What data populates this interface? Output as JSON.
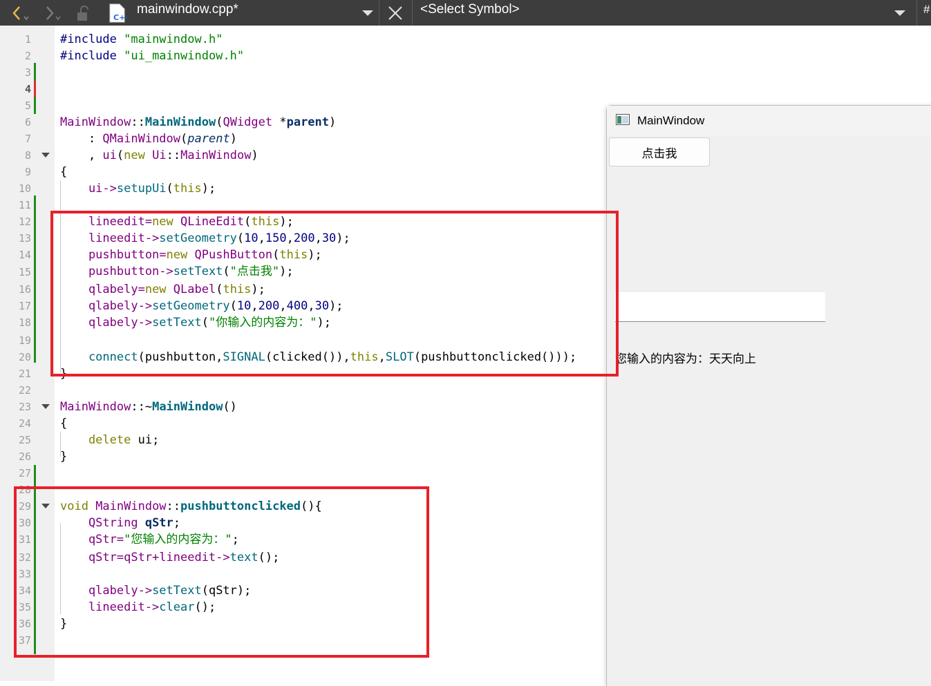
{
  "toolbar": {
    "file_name": "mainwindow.cpp*",
    "symbol_select": "<Select Symbol>",
    "hash_label": "#"
  },
  "gutter": {
    "line_numbers": [
      "1",
      "2",
      "3",
      "4",
      "5",
      "6",
      "7",
      "8",
      "9",
      "10",
      "11",
      "12",
      "13",
      "14",
      "15",
      "16",
      "17",
      "18",
      "19",
      "20",
      "21",
      "22",
      "23",
      "24",
      "25",
      "26",
      "27",
      "28",
      "29",
      "30",
      "31",
      "32",
      "33",
      "34",
      "35",
      "36",
      "37"
    ],
    "current_line": "4"
  },
  "code": {
    "line1_directive": "#include ",
    "line1_header": "\"mainwindow.h\"",
    "line2_directive": "#include ",
    "line2_header": "\"ui_mainwindow.h\"",
    "line6_class": "MainWindow",
    "line6_sep": "::",
    "line6_ctor": "MainWindow",
    "line6_open": "(",
    "line6_type": "QWidget",
    "line6_star": " *",
    "line6_param": "parent",
    "line6_close": ")",
    "line7_colon": "    : ",
    "line7_base": "QMainWindow",
    "line7_open": "(",
    "line7_arg": "parent",
    "line7_close": ")",
    "line8_comma": "    , ",
    "line8_member": "ui",
    "line8_open": "(",
    "line8_new": "new ",
    "line8_ns": "Ui",
    "line8_sep": "::",
    "line8_type": "MainWindow",
    "line8_close": ")",
    "line9": "{",
    "line10_obj": "    ui->",
    "line10_fn": "setupUi",
    "line10_open": "(",
    "line10_this": "this",
    "line10_close": ");",
    "line12_var": "    lineedit=",
    "line12_new": "new ",
    "line12_type": "QLineEdit",
    "line12_open": "(",
    "line12_this": "this",
    "line12_close": ");",
    "line13_var": "    lineedit->",
    "line13_fn": "setGeometry",
    "line13_open": "(",
    "line13_n1": "10",
    "line13_n2": "150",
    "line13_n3": "200",
    "line13_n4": "30",
    "line13_close": ");",
    "line14_var": "    pushbutton=",
    "line14_new": "new ",
    "line14_type": "QPushButton",
    "line14_open": "(",
    "line14_this": "this",
    "line14_close": ");",
    "line15_var": "    pushbutton->",
    "line15_fn": "setText",
    "line15_open": "(",
    "line15_str": "\"点击我\"",
    "line15_close": ");",
    "line16_var": "    qlabely=",
    "line16_new": "new ",
    "line16_type": "QLabel",
    "line16_open": "(",
    "line16_this": "this",
    "line16_close": ");",
    "line17_var": "    qlabely->",
    "line17_fn": "setGeometry",
    "line17_open": "(",
    "line17_n1": "10",
    "line17_n2": "200",
    "line17_n3": "400",
    "line17_n4": "30",
    "line17_close": ");",
    "line18_var": "    qlabely->",
    "line18_fn": "setText",
    "line18_open": "(",
    "line18_str": "\"你输入的内容为：\"",
    "line18_close": ");",
    "line20_fn": "    connect",
    "line20_open": "(pushbutton,",
    "line20_sig": "SIGNAL",
    "line20_sigarg": "(clicked()),",
    "line20_this": "this",
    "line20_comma": ",",
    "line20_slot": "SLOT",
    "line20_slotarg": "(pushbuttonclicked()));",
    "line21": "}",
    "line23_class": "MainWindow",
    "line23_sep": "::~",
    "line23_dtor": "MainWindow",
    "line23_parens": "()",
    "line24": "{",
    "line25_kw": "    delete ",
    "line25_rest": "ui;",
    "line26": "}",
    "line29_void": "void ",
    "line29_class": "MainWindow",
    "line29_sep": "::",
    "line29_fn": "pushbuttonclicked",
    "line29_rest": "(){",
    "line30_type": "    QString ",
    "line30_var": "qStr",
    "line30_semi": ";",
    "line31_var": "    qStr=",
    "line31_str": "\"您输入的内容为：\"",
    "line31_semi": ";",
    "line32_var": "    qStr=qStr+lineedit->",
    "line32_fn": "text",
    "line32_rest": "();",
    "line34_var": "    qlabely->",
    "line34_fn": "setText",
    "line34_rest": "(qStr);",
    "line35_var": "    lineedit->",
    "line35_fn": "clear",
    "line35_rest": "();",
    "line36": "}"
  },
  "preview": {
    "title": "MainWindow",
    "button_label": "点击我",
    "lineedit_value": "",
    "label_text": "您输入的内容为：天天向上"
  },
  "colors": {
    "highlight_box": "#e8202a",
    "change_marker": "#1e8c1e",
    "toolbar_bg": "#3d3d3d"
  },
  "icons": [
    "back-arrow-icon",
    "forward-arrow-icon",
    "lock-icon",
    "cpp-file-icon",
    "chevron-down-icon",
    "close-icon",
    "window-app-icon"
  ]
}
